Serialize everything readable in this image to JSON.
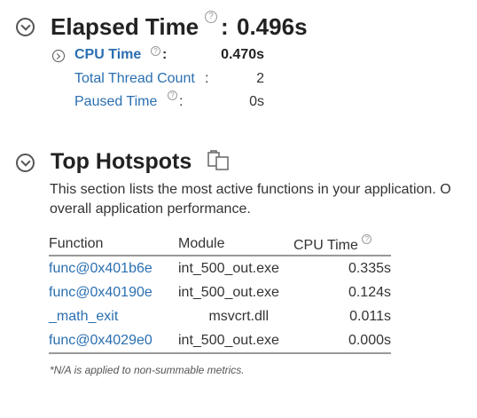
{
  "summary": {
    "title": "Elapsed Time",
    "value": "0.496s",
    "help_glyph": "?",
    "colon": ":",
    "metrics": [
      {
        "label": "CPU Time",
        "value": "0.470s"
      },
      {
        "label": "Total Thread Count",
        "value": "2"
      },
      {
        "label": "Paused Time",
        "value": "0s"
      }
    ]
  },
  "hotspots": {
    "title": "Top Hotspots",
    "copy_icon": "copy-icon",
    "description_line1": "This section lists the most active functions in your application. O",
    "description_line2": "overall application performance.",
    "columns": {
      "function": "Function",
      "module": "Module",
      "cpu_time": "CPU Time"
    },
    "rows": [
      {
        "function": "func@0x401b6e",
        "module": "int_500_out.exe",
        "cpu_time": "0.335s"
      },
      {
        "function": "func@0x40190e",
        "module": "int_500_out.exe",
        "cpu_time": "0.124s"
      },
      {
        "function": "_math_exit",
        "module": "msvcrt.dll",
        "cpu_time": "0.011s"
      },
      {
        "function": "func@0x4029e0",
        "module": "int_500_out.exe",
        "cpu_time": "0.000s"
      }
    ],
    "footnote": "*N/A is applied to non-summable metrics."
  },
  "colors": {
    "link": "#2a6fb1",
    "text": "#222222",
    "muted": "#999999"
  }
}
